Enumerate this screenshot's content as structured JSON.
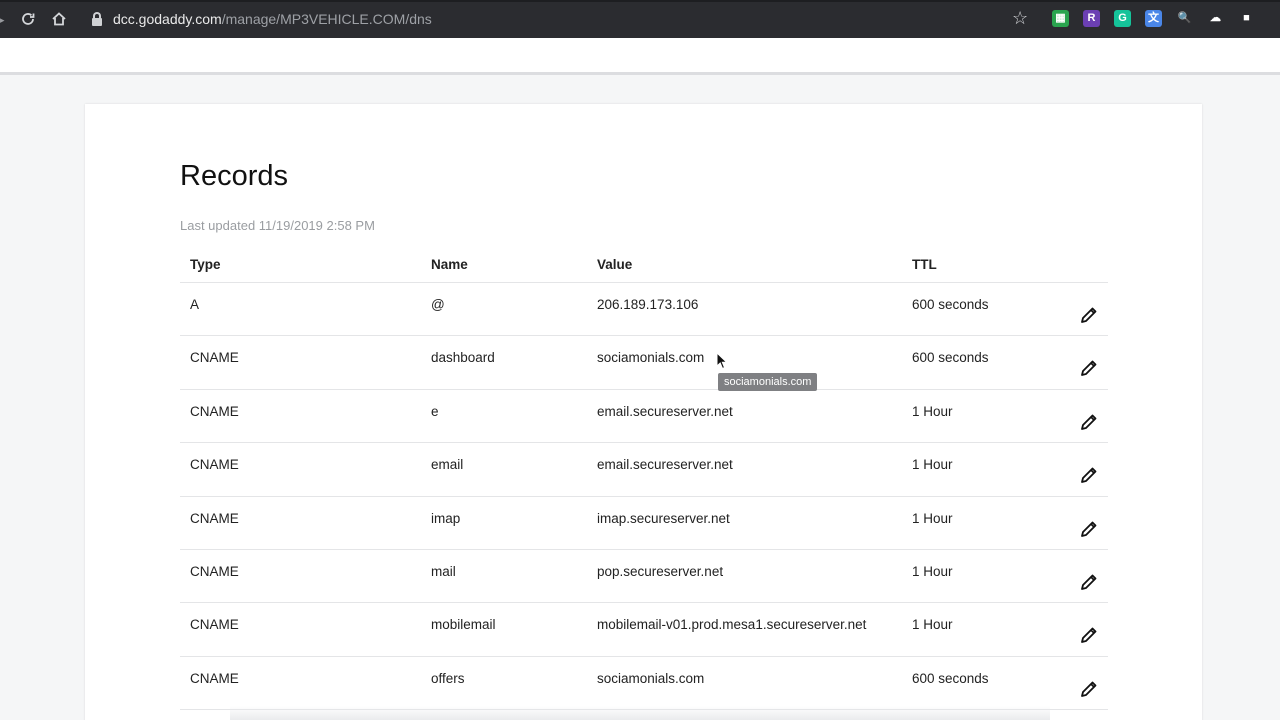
{
  "browser": {
    "url_host": "dcc.godaddy.com",
    "url_path": "/manage/MP3VEHICLE.COM/dns",
    "extensions": [
      {
        "name": "grid-extension-icon",
        "glyph": "▦",
        "color": "#2aa44f"
      },
      {
        "name": "r-extension-icon",
        "glyph": "R",
        "color": "#6b3fb3"
      },
      {
        "name": "grammarly-extension-icon",
        "glyph": "G",
        "color": "#15c39a"
      },
      {
        "name": "translate-extension-icon",
        "glyph": "文",
        "color": "#4a86e8"
      },
      {
        "name": "search-extension-icon",
        "glyph": "🔍",
        "color": "#2b2c30"
      },
      {
        "name": "cloud-extension-icon",
        "glyph": "☁",
        "color": "#2b2c30"
      },
      {
        "name": "dark-extension-icon",
        "glyph": "■",
        "color": "#2b2c30"
      }
    ]
  },
  "records": {
    "title": "Records",
    "last_updated": "Last updated 11/19/2019 2:58 PM",
    "columns": {
      "type": "Type",
      "name": "Name",
      "value": "Value",
      "ttl": "TTL"
    },
    "rows": [
      {
        "type": "A",
        "name": "@",
        "value": "206.189.173.106",
        "ttl": "600 seconds"
      },
      {
        "type": "CNAME",
        "name": "dashboard",
        "value": "sociamonials.com",
        "ttl": "600 seconds"
      },
      {
        "type": "CNAME",
        "name": "e",
        "value": "email.secureserver.net",
        "ttl": "1 Hour"
      },
      {
        "type": "CNAME",
        "name": "email",
        "value": "email.secureserver.net",
        "ttl": "1 Hour"
      },
      {
        "type": "CNAME",
        "name": "imap",
        "value": "imap.secureserver.net",
        "ttl": "1 Hour"
      },
      {
        "type": "CNAME",
        "name": "mail",
        "value": "pop.secureserver.net",
        "ttl": "1 Hour"
      },
      {
        "type": "CNAME",
        "name": "mobilemail",
        "value": "mobilemail-v01.prod.mesa1.secureserver.net",
        "ttl": "1 Hour"
      },
      {
        "type": "CNAME",
        "name": "offers",
        "value": "sociamonials.com",
        "ttl": "600 seconds"
      }
    ]
  },
  "tooltip": {
    "text": "sociamonials.com"
  }
}
